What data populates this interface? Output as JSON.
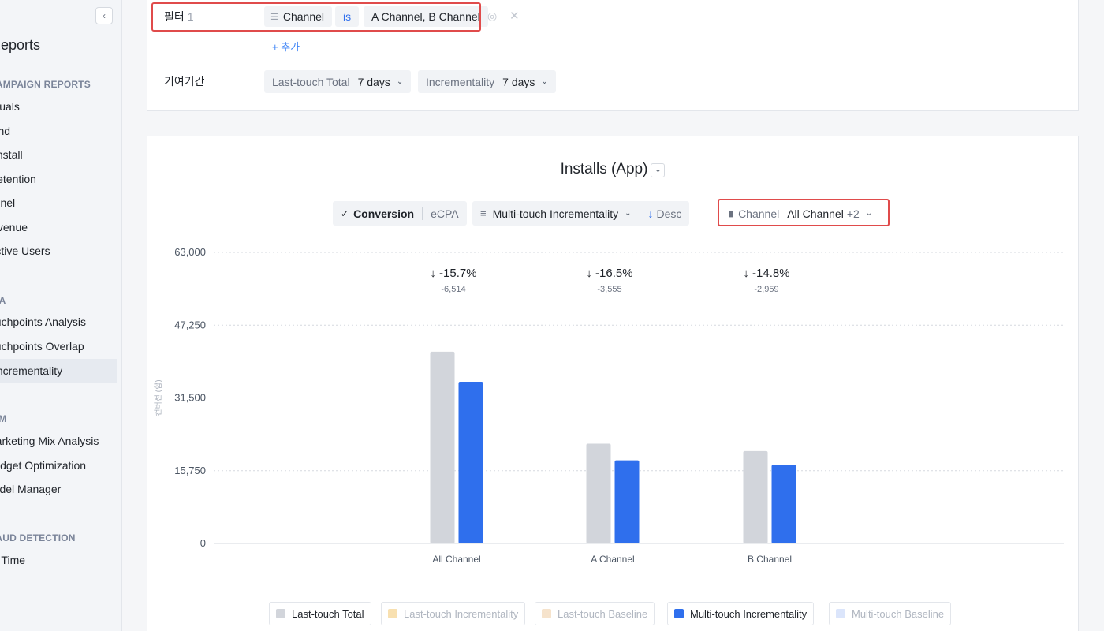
{
  "sidebar": {
    "collapse_icon": "‹",
    "title": "Reports",
    "sections": {
      "campaign": "CAMPAIGN REPORTS",
      "ta": "TA",
      "mm": "MM",
      "fraud": "FRAUD DETECTION"
    },
    "items": {
      "visuals": "Visuals",
      "trend": "Trend",
      "install": "Install",
      "retention": "Retention",
      "channel": "Channel",
      "revenue": "Revenue",
      "active_users": "Active Users",
      "touchpoints_analysis": "Touchpoints Analysis",
      "touchpoints_overlap": "Touchpoints Overlap",
      "incrementality": "Incrementality",
      "marketing_mix": "Marketing Mix Analysis",
      "budget_opt": "Budget Optimization",
      "model_manager": "Model Manager",
      "real_time": "Real Time"
    }
  },
  "filters": {
    "label": "필터",
    "count": "1",
    "dimension": "Channel",
    "operator": "is",
    "value": "A Channel, B Channel",
    "add_label": "+ 추가",
    "attribution_label": "기여기간",
    "last_touch_label": "Last-touch Total",
    "last_touch_value": "7 days",
    "incrementality_label": "Incrementality",
    "incrementality_value": "7 days"
  },
  "chart_controls": {
    "title": "Installs (App)",
    "conversion": "Conversion",
    "ecpa": "eCPA",
    "sort_metric": "Multi-touch Incrementality",
    "sort_dir": "Desc",
    "group_label": "Channel",
    "group_value": "All Channel",
    "group_more": "+2"
  },
  "chart_data": {
    "type": "bar",
    "title": "Installs (App)",
    "ylabel": "컨버전 (합)",
    "ylim": [
      0,
      63000
    ],
    "yticks": [
      "0",
      "15,750",
      "31,500",
      "47,250",
      "63,000"
    ],
    "categories": [
      "All Channel",
      "A Channel",
      "B Channel"
    ],
    "series": [
      {
        "name": "Last-touch Total",
        "color": "#d2d5db",
        "values": [
          41500,
          21600,
          20000
        ]
      },
      {
        "name": "Multi-touch Incrementality",
        "color": "#2f6fed",
        "values": [
          35000,
          18000,
          17000
        ]
      }
    ],
    "annotations": [
      {
        "pct": "-15.7%",
        "diff": "-6,514"
      },
      {
        "pct": "-16.5%",
        "diff": "-3,555"
      },
      {
        "pct": "-14.8%",
        "diff": "-2,959"
      }
    ]
  },
  "legend": [
    {
      "label": "Last-touch Total",
      "color": "#d2d5db",
      "active": true
    },
    {
      "label": "Last-touch Incrementality",
      "color": "#f8e0b0",
      "active": false
    },
    {
      "label": "Last-touch Baseline",
      "color": "#f6e3cc",
      "active": false
    },
    {
      "label": "Multi-touch Incrementality",
      "color": "#2f6fed",
      "active": true
    },
    {
      "label": "Multi-touch Baseline",
      "color": "#dbe5fb",
      "active": false
    }
  ]
}
